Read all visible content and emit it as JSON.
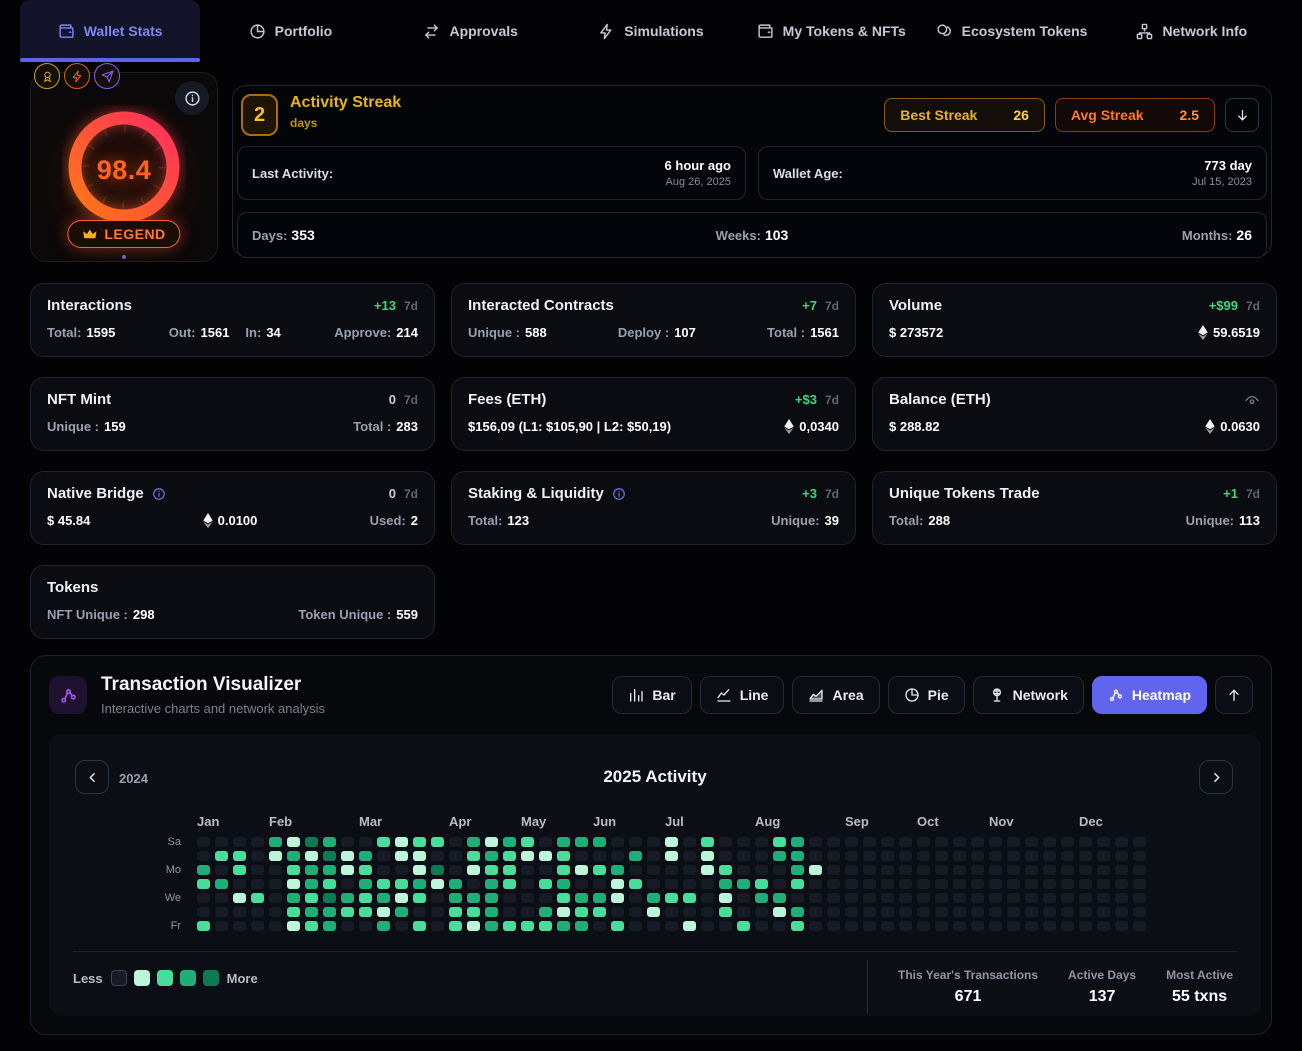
{
  "colors": {
    "accent": "#6366f1",
    "gold": "#eab308",
    "orange": "#f97316",
    "green": "#3fd97c"
  },
  "nav": {
    "items": [
      {
        "label": "Wallet Stats",
        "icon": "wallet-icon",
        "active": true
      },
      {
        "label": "Portfolio",
        "icon": "pie-icon",
        "active": false
      },
      {
        "label": "Approvals",
        "icon": "swap-icon",
        "active": false
      },
      {
        "label": "Simulations",
        "icon": "bolt-icon",
        "active": false
      },
      {
        "label": "My Tokens & NFTs",
        "icon": "wallet-icon",
        "active": false
      },
      {
        "label": "Ecosystem Tokens",
        "icon": "coins-icon",
        "active": false
      },
      {
        "label": "Network Info",
        "icon": "network-icon",
        "active": false
      }
    ]
  },
  "score_card": {
    "score": "98.4",
    "tier_label": "LEGEND",
    "tier_icon": "crown-icon",
    "info_icon": "info-icon",
    "badges": [
      {
        "icon": "medal-icon",
        "color": "#c9a60e"
      },
      {
        "icon": "bolt-icon",
        "color": "#e55d12"
      },
      {
        "icon": "send-icon",
        "color": "#8b5cf6"
      }
    ]
  },
  "streak": {
    "value": "2",
    "title": "Activity Streak",
    "unit": "days",
    "best_label": "Best Streak",
    "best_value": "26",
    "avg_label": "Avg Streak",
    "avg_value": "2.5",
    "collapse_icon": "arrow-down-icon",
    "last_activity_label": "Last Activity:",
    "last_activity_value": "6 hour ago",
    "last_activity_date": "Aug 26, 2025",
    "wallet_age_label": "Wallet Age:",
    "wallet_age_value": "773 day",
    "wallet_age_date": "Jul 15, 2023",
    "days_label": "Days:",
    "days_value": "353",
    "weeks_label": "Weeks:",
    "weeks_value": "103",
    "months_label": "Months:",
    "months_value": "26"
  },
  "stats": {
    "cards": [
      {
        "title": "Interactions",
        "change": "+13",
        "change_color": "green",
        "period": "7d",
        "groups": [
          [
            {
              "label": "Total:",
              "value": "1595"
            }
          ],
          [
            {
              "label": "Out:",
              "value": "1561"
            },
            {
              "label": "In:",
              "value": "34"
            }
          ],
          [
            {
              "label": "Approve:",
              "value": "214"
            }
          ]
        ]
      },
      {
        "title": "Interacted Contracts",
        "change": "+7",
        "change_color": "green",
        "period": "7d",
        "groups": [
          [
            {
              "label": "Unique :",
              "value": "588"
            }
          ],
          [
            {
              "label": "Deploy :",
              "value": "107"
            }
          ],
          [
            {
              "label": "Total :",
              "value": "1561"
            }
          ]
        ]
      },
      {
        "title": "Volume",
        "change": "+$99",
        "change_color": "green",
        "period": "7d",
        "groups": [
          [
            {
              "value": "$ 273572"
            }
          ],
          [
            {
              "icon": "eth-icon",
              "value": "59.6519"
            }
          ]
        ]
      },
      {
        "title": "NFT Mint",
        "change": "0",
        "change_color": "muted",
        "period": "7d",
        "groups": [
          [
            {
              "label": "Unique :",
              "value": "159"
            }
          ],
          [
            {
              "label": "Total :",
              "value": "283"
            }
          ]
        ]
      },
      {
        "title": "Fees (ETH)",
        "change": "+$3",
        "change_color": "green",
        "period": "7d",
        "groups": [
          [
            {
              "value": "$156,09 (L1: $105,90 | L2: $50,19)"
            }
          ],
          [
            {
              "icon": "eth-icon",
              "value": "0,0340"
            }
          ]
        ]
      },
      {
        "title": "Balance (ETH)",
        "header_icon": "eye-icon",
        "groups": [
          [
            {
              "value": "$ 288.82"
            }
          ],
          [
            {
              "icon": "eth-icon",
              "value": "0.0630"
            }
          ]
        ]
      },
      {
        "title": "Native Bridge",
        "title_icon": "info-icon",
        "change": "0",
        "change_color": "muted",
        "period": "7d",
        "groups": [
          [
            {
              "value": "$ 45.84"
            }
          ],
          [
            {
              "icon": "eth-icon",
              "value": "0.0100"
            }
          ],
          [
            {
              "label": "Used:",
              "value": "2"
            }
          ]
        ]
      },
      {
        "title": "Staking & Liquidity",
        "title_icon": "info-icon",
        "change": "+3",
        "change_color": "green",
        "period": "7d",
        "groups": [
          [
            {
              "label": "Total:",
              "value": "123"
            }
          ],
          [
            {
              "label": "Unique:",
              "value": "39"
            }
          ]
        ]
      },
      {
        "title": "Unique Tokens Trade",
        "change": "+1",
        "change_color": "green",
        "period": "7d",
        "groups": [
          [
            {
              "label": "Total:",
              "value": "288"
            }
          ],
          [
            {
              "label": "Unique:",
              "value": "113"
            }
          ]
        ]
      },
      {
        "title": "Tokens",
        "groups": [
          [
            {
              "label": "NFT Unique :",
              "value": "298"
            }
          ],
          [
            {
              "label": "Token Unique :",
              "value": "559"
            }
          ]
        ]
      }
    ]
  },
  "visualizer": {
    "title": "Transaction Visualizer",
    "subtitle": "Interactive charts and network analysis",
    "icon": "scatter-icon",
    "buttons": [
      {
        "label": "Bar",
        "icon": "bar-icon",
        "active": false
      },
      {
        "label": "Line",
        "icon": "line-icon",
        "active": false
      },
      {
        "label": "Area",
        "icon": "area-icon",
        "active": false
      },
      {
        "label": "Pie",
        "icon": "pie-icon",
        "active": false
      },
      {
        "label": "Network",
        "icon": "globe-icon",
        "active": false
      },
      {
        "label": "Heatmap",
        "icon": "scatter-icon",
        "active": true
      }
    ],
    "expand_icon": "arrow-up-icon"
  },
  "chart_data": {
    "type": "heatmap",
    "title": "2025 Activity",
    "prev_year": "2024",
    "day_labels": [
      "Sa",
      "",
      "Mo",
      "",
      "We",
      "",
      "Fr"
    ],
    "months": [
      {
        "label": "Jan",
        "col": 0
      },
      {
        "label": "Feb",
        "col": 4
      },
      {
        "label": "Mar",
        "col": 9
      },
      {
        "label": "Apr",
        "col": 14
      },
      {
        "label": "May",
        "col": 18
      },
      {
        "label": "Jun",
        "col": 22
      },
      {
        "label": "Jul",
        "col": 26
      },
      {
        "label": "Aug",
        "col": 31
      },
      {
        "label": "Sep",
        "col": 36
      },
      {
        "label": "Oct",
        "col": 40
      },
      {
        "label": "Nov",
        "col": 44
      },
      {
        "label": "Dec",
        "col": 49
      }
    ],
    "palette": [
      "#161b25",
      "#bdf5da",
      "#49dd9c",
      "#1fae77",
      "#0c7a52"
    ],
    "grid_rows": [
      "00003143002122031320333000102000230000000000000000000",
      "02201314130110023211200030101000330000000000000000000",
      "30200233120014012200212300001200031000000000000000000",
      "23000132032231303202300120000332020000000000000000000",
      "00120324323120333000233103220103300000000000000000000",
      "00000233221300223003122001000200130000000000000000000",
      "20000123003020213222330200010020020000000000000000000"
    ],
    "legend": {
      "less": "Less",
      "more": "More",
      "levels": [
        0,
        1,
        2,
        3,
        4
      ]
    },
    "stats": [
      {
        "label": "This Year's Transactions",
        "value": "671"
      },
      {
        "label": "Active Days",
        "value": "137"
      },
      {
        "label": "Most Active",
        "value": "55 txns"
      }
    ]
  }
}
